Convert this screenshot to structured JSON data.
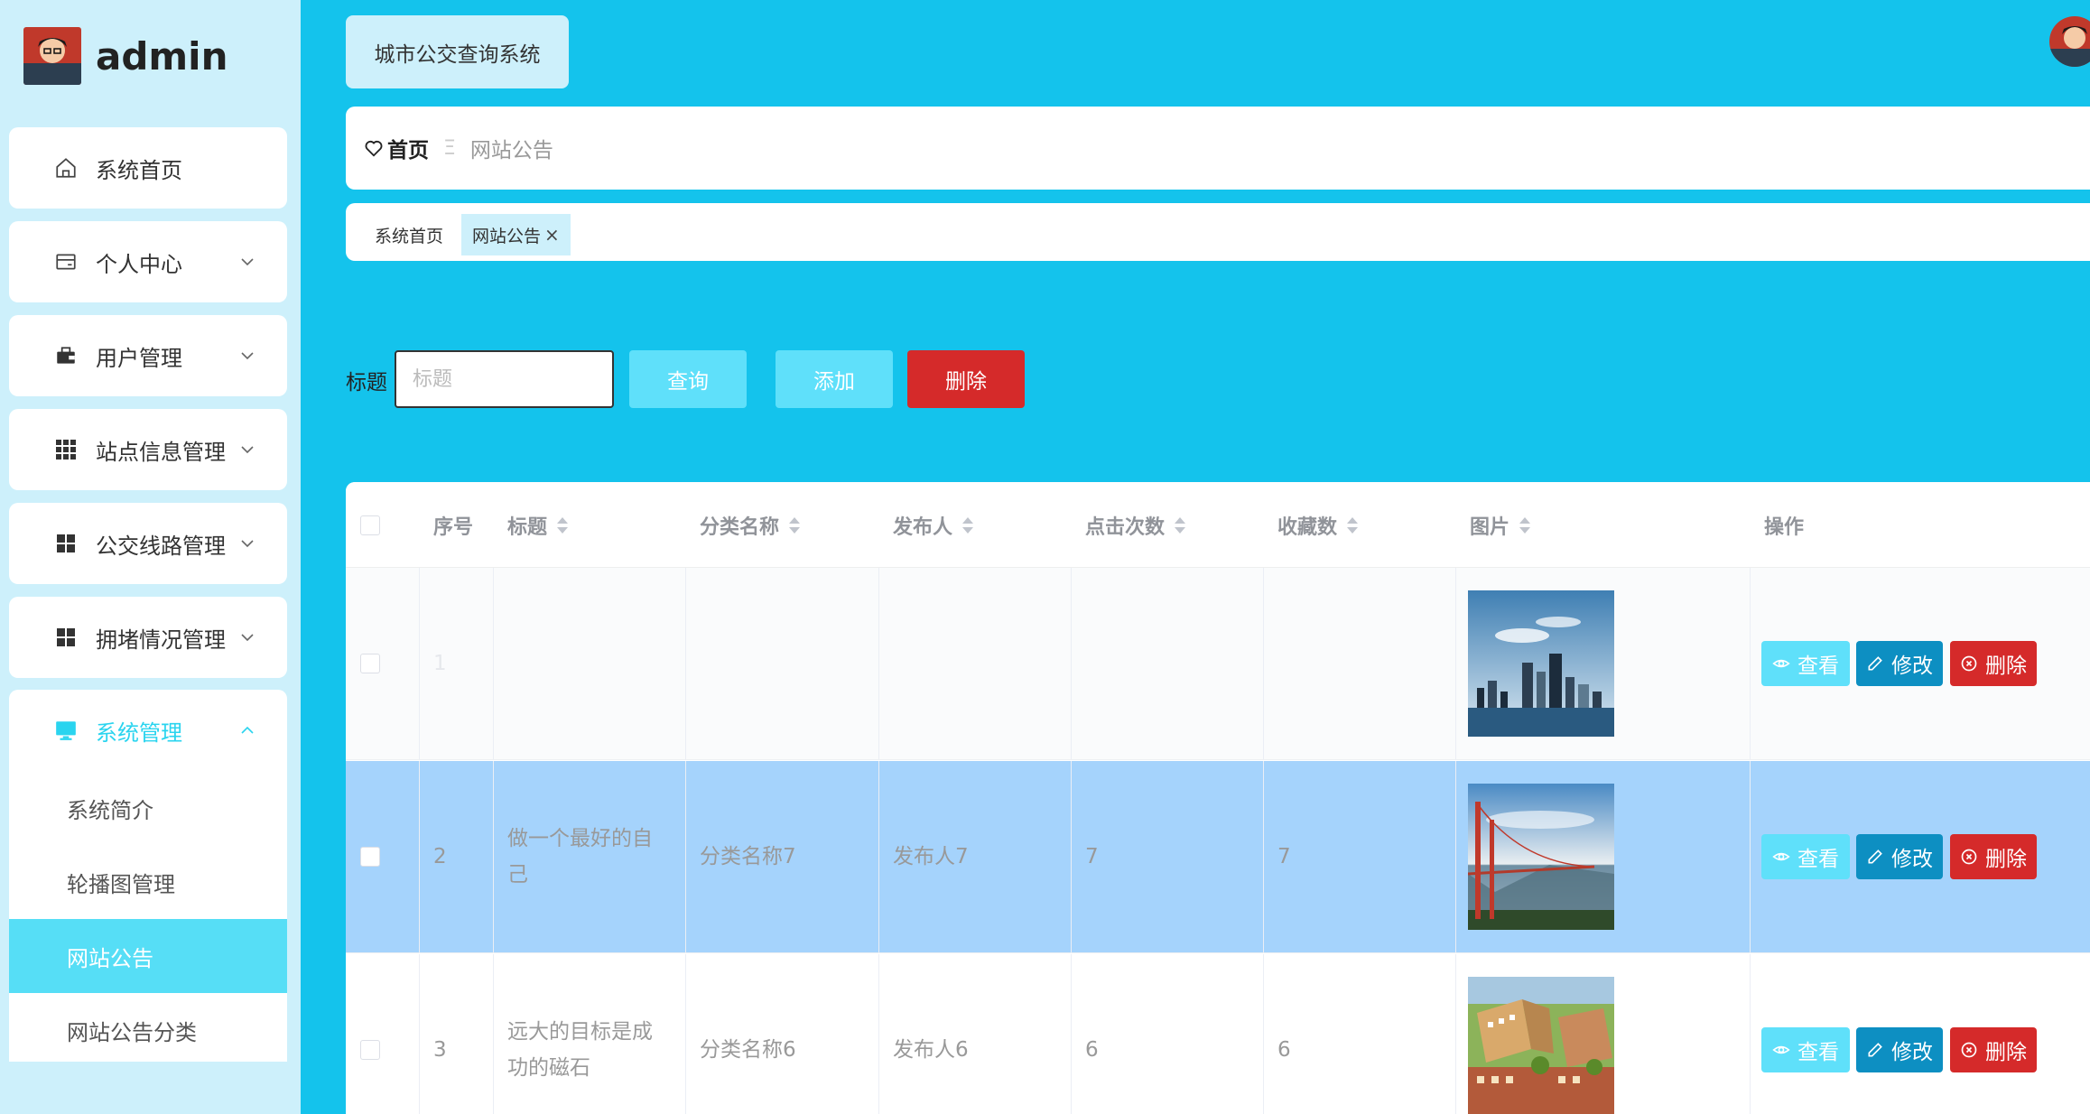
{
  "sidebar": {
    "brand": "admin",
    "items": [
      {
        "label": "系统首页"
      },
      {
        "label": "个人中心"
      },
      {
        "label": "用户管理"
      },
      {
        "label": "站点信息管理"
      },
      {
        "label": "公交线路管理"
      },
      {
        "label": "拥堵情况管理"
      }
    ],
    "open_group": {
      "label": "系统管理",
      "children": [
        {
          "label": "系统简介"
        },
        {
          "label": "轮播图管理"
        },
        {
          "label": "网站公告",
          "active": true
        },
        {
          "label": "网站公告分类"
        }
      ]
    }
  },
  "header": {
    "system_title": "城市公交查询系统"
  },
  "breadcrumb": {
    "home": "首页",
    "separator": "Ξ",
    "current": "网站公告"
  },
  "tabs": [
    {
      "label": "系统首页"
    },
    {
      "label": "网站公告",
      "close": "×",
      "active": true
    }
  ],
  "search": {
    "label": "标题",
    "placeholder": "标题",
    "query_button": "查询",
    "add_button": "添加",
    "delete_button": "删除"
  },
  "table": {
    "columns": [
      "序号",
      "标题",
      "分类名称",
      "发布人",
      "点击次数",
      "收藏数",
      "图片",
      "操作"
    ],
    "rows": [
      {
        "index": "1",
        "title_l1": "",
        "title_l2": "",
        "category": "",
        "publisher": "",
        "clicks": "",
        "favorites": ""
      },
      {
        "index": "2",
        "title_l1": "做一个最好的自",
        "title_l2": "己",
        "category": "分类名称7",
        "publisher": "发布人7",
        "clicks": "7",
        "favorites": "7"
      },
      {
        "index": "3",
        "title_l1": "远大的目标是成",
        "title_l2": "功的磁石",
        "category": "分类名称6",
        "publisher": "发布人6",
        "clicks": "6",
        "favorites": "6"
      }
    ],
    "actions": {
      "view": "查看",
      "edit": "修改",
      "delete": "删除"
    }
  },
  "colors": {
    "page_bg": "#14c3ec",
    "sidebar_bg": "#cdf0fb",
    "accent": "#5fe0fa",
    "edit_blue": "#0d8fc2",
    "danger": "#d52a2a",
    "selected_row": "#a5d3fc"
  }
}
